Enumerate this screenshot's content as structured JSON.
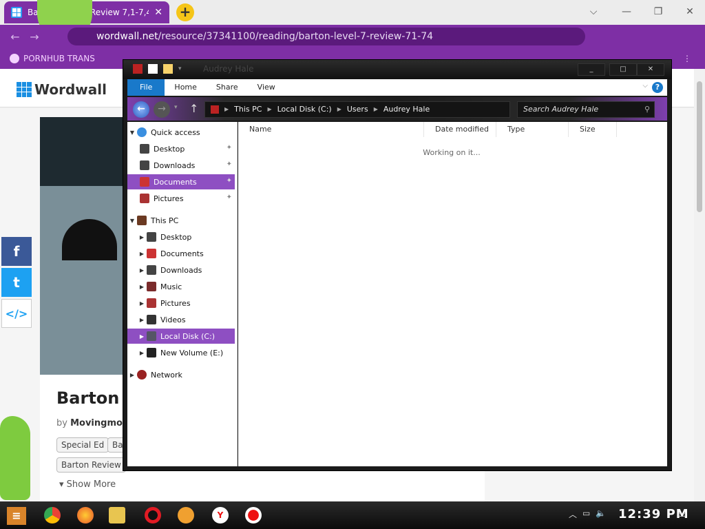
{
  "browser": {
    "tab_title": "Barton Level 7 Review 7,1-7,4",
    "tab_close": "✕",
    "new_tab": "+",
    "window_controls": [
      "⌵",
      "—",
      "❐",
      "✕"
    ],
    "url_host": "wordwall.net",
    "url_path": "/resource/37341100/reading/barton-level-7-review-71-74",
    "bookmarks": [
      "PORNHUB TRANS"
    ],
    "bookmark_more": "⋮"
  },
  "wordwall": {
    "logo_text": "Wordwall",
    "title": "Barton L",
    "by_label": "by",
    "author": "Movingmou",
    "tags": [
      "Special Ed",
      "Ba",
      "Barton Review"
    ],
    "show_more": "▾ Show More",
    "social": [
      "f",
      "t",
      "</>"
    ],
    "colors": {
      "facebook": "#3b5998",
      "twitter": "#1da1f2"
    }
  },
  "explorer": {
    "title": "Audrey Hale",
    "window_buttons": [
      "_",
      "□",
      "✕"
    ],
    "ribbon_tabs": [
      "File",
      "Home",
      "Share",
      "View"
    ],
    "help": "?",
    "breadcrumbs": [
      "This PC",
      "Local Disk (C:)",
      "Users",
      "Audrey Hale"
    ],
    "search_placeholder": "Search Audrey Hale",
    "nav": {
      "quick_access": "Quick access",
      "quick_items": [
        "Desktop",
        "Downloads",
        "Documents",
        "Pictures"
      ],
      "this_pc": "This PC",
      "pc_items": [
        "Desktop",
        "Documents",
        "Downloads",
        "Music",
        "Pictures",
        "Videos",
        "Local Disk (C:)",
        "New Volume (E:)"
      ],
      "network": "Network"
    },
    "columns": [
      "Name",
      "Date modified",
      "Type",
      "Size"
    ],
    "status": "Working on it...",
    "selection_color": "#8e4fc2"
  },
  "taskbar": {
    "clock": "12:39 PM",
    "apps": [
      "chrome",
      "firefox",
      "file-explorer",
      "opera",
      "brave",
      "yandex",
      "recorder"
    ]
  }
}
